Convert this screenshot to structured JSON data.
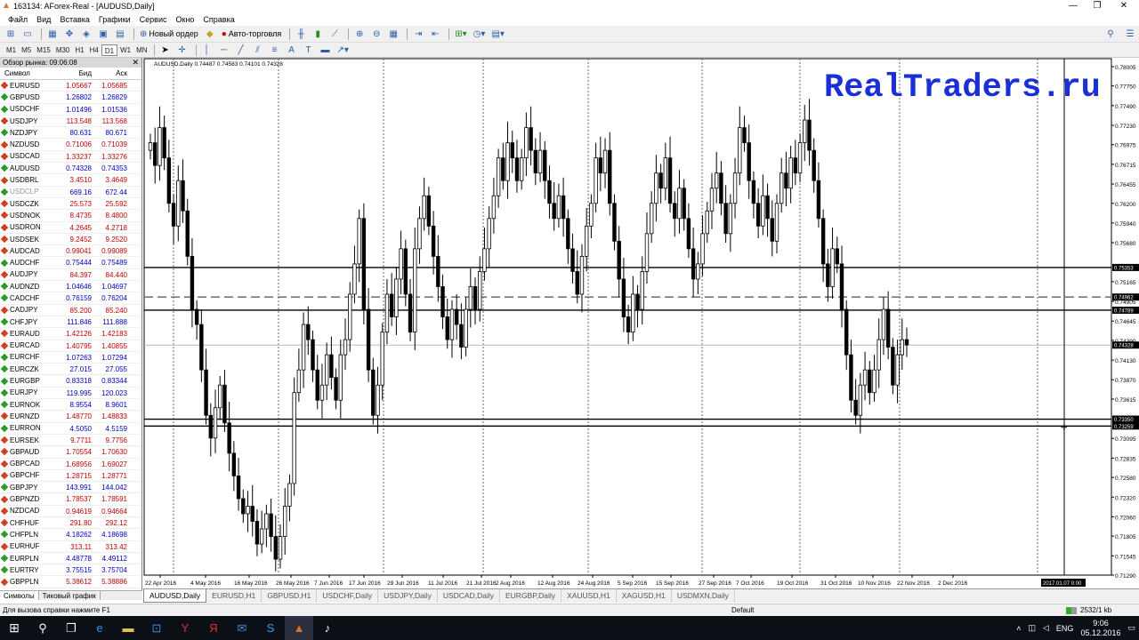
{
  "window": {
    "title": "163134: AForex-Real - [AUDUSD,Daily]"
  },
  "menu": [
    "Файл",
    "Вид",
    "Вставка",
    "Графики",
    "Сервис",
    "Окно",
    "Справка"
  ],
  "toolbar": {
    "new_order": "Новый ордер",
    "autotrade": "Авто-торговля"
  },
  "timeframes": [
    "M1",
    "M5",
    "M15",
    "M30",
    "H1",
    "H4",
    "D1",
    "W1",
    "MN"
  ],
  "timeframe_selected": "D1",
  "market_watch": {
    "title": "Обзор рынка: 09:06:08",
    "col_symbol": "Символ",
    "col_bid": "Бид",
    "col_ask": "Аск",
    "rows": [
      {
        "s": "EURUSD",
        "b": "1.05667",
        "a": "1.05685",
        "c": "#c00000"
      },
      {
        "s": "GBPUSD",
        "b": "1.26802",
        "a": "1.26829",
        "c": "#0000c0"
      },
      {
        "s": "USDCHF",
        "b": "1.01496",
        "a": "1.01536",
        "c": "#0000c0"
      },
      {
        "s": "USDJPY",
        "b": "113.548",
        "a": "113.568",
        "c": "#c00000"
      },
      {
        "s": "NZDJPY",
        "b": "80.631",
        "a": "80.671",
        "c": "#0000c0"
      },
      {
        "s": "NZDUSD",
        "b": "0.71006",
        "a": "0.71039",
        "c": "#c00000"
      },
      {
        "s": "USDCAD",
        "b": "1.33237",
        "a": "1.33276",
        "c": "#c00000"
      },
      {
        "s": "AUDUSD",
        "b": "0.74328",
        "a": "0.74353",
        "c": "#0000c0"
      },
      {
        "s": "USDBRL",
        "b": "3.4510",
        "a": "3.4649",
        "c": "#c00000"
      },
      {
        "s": "USDCLP",
        "b": "669.16",
        "a": "672.44",
        "c": "#0000c0",
        "dim": true
      },
      {
        "s": "USDCZK",
        "b": "25.573",
        "a": "25.592",
        "c": "#c00000"
      },
      {
        "s": "USDNOK",
        "b": "8.4735",
        "a": "8.4800",
        "c": "#c00000"
      },
      {
        "s": "USDRON",
        "b": "4.2645",
        "a": "4.2718",
        "c": "#c00000"
      },
      {
        "s": "USDSEK",
        "b": "9.2452",
        "a": "9.2520",
        "c": "#c00000"
      },
      {
        "s": "AUDCAD",
        "b": "0.99041",
        "a": "0.99089",
        "c": "#c00000"
      },
      {
        "s": "AUDCHF",
        "b": "0.75444",
        "a": "0.75489",
        "c": "#0000c0"
      },
      {
        "s": "AUDJPY",
        "b": "84.397",
        "a": "84.440",
        "c": "#c00000"
      },
      {
        "s": "AUDNZD",
        "b": "1.04646",
        "a": "1.04697",
        "c": "#0000c0"
      },
      {
        "s": "CADCHF",
        "b": "0.76159",
        "a": "0.76204",
        "c": "#0000c0"
      },
      {
        "s": "CADJPY",
        "b": "85.200",
        "a": "85.240",
        "c": "#c00000"
      },
      {
        "s": "CHFJPY",
        "b": "111.846",
        "a": "111.888",
        "c": "#0000c0"
      },
      {
        "s": "EURAUD",
        "b": "1.42126",
        "a": "1.42183",
        "c": "#c00000"
      },
      {
        "s": "EURCAD",
        "b": "1.40795",
        "a": "1.40855",
        "c": "#c00000"
      },
      {
        "s": "EURCHF",
        "b": "1.07263",
        "a": "1.07294",
        "c": "#0000c0"
      },
      {
        "s": "EURCZK",
        "b": "27.015",
        "a": "27.055",
        "c": "#0000c0"
      },
      {
        "s": "EURGBP",
        "b": "0.83318",
        "a": "0.83344",
        "c": "#0000c0"
      },
      {
        "s": "EURJPY",
        "b": "119.995",
        "a": "120.023",
        "c": "#0000c0"
      },
      {
        "s": "EURNOK",
        "b": "8.9554",
        "a": "8.9601",
        "c": "#0000c0"
      },
      {
        "s": "EURNZD",
        "b": "1.48770",
        "a": "1.48833",
        "c": "#c00000"
      },
      {
        "s": "EURRON",
        "b": "4.5050",
        "a": "4.5159",
        "c": "#0000c0"
      },
      {
        "s": "EURSEK",
        "b": "9.7711",
        "a": "9.7756",
        "c": "#c00000"
      },
      {
        "s": "GBPAUD",
        "b": "1.70554",
        "a": "1.70630",
        "c": "#c00000"
      },
      {
        "s": "GBPCAD",
        "b": "1.68956",
        "a": "1.69027",
        "c": "#c00000"
      },
      {
        "s": "GBPCHF",
        "b": "1.28715",
        "a": "1.28771",
        "c": "#c00000"
      },
      {
        "s": "GBPJPY",
        "b": "143.991",
        "a": "144.042",
        "c": "#0000c0"
      },
      {
        "s": "GBPNZD",
        "b": "1.78537",
        "a": "1.78591",
        "c": "#c00000"
      },
      {
        "s": "NZDCAD",
        "b": "0.94619",
        "a": "0.94664",
        "c": "#c00000"
      },
      {
        "s": "CHFHUF",
        "b": "291.80",
        "a": "292.12",
        "c": "#c00000"
      },
      {
        "s": "CHFPLN",
        "b": "4.18262",
        "a": "4.18698",
        "c": "#0000c0"
      },
      {
        "s": "EURHUF",
        "b": "313.11",
        "a": "313.42",
        "c": "#c00000"
      },
      {
        "s": "EURPLN",
        "b": "4.48778",
        "a": "4.49112",
        "c": "#0000c0"
      },
      {
        "s": "EURTRY",
        "b": "3.75515",
        "a": "3.75704",
        "c": "#0000c0"
      },
      {
        "s": "GBPPLN",
        "b": "5.38612",
        "a": "5.38886",
        "c": "#c00000"
      }
    ],
    "tabs": [
      "Символы",
      "Тиковый график"
    ]
  },
  "chart": {
    "header": "AUDUSD,Daily  0.74487 0.74583 0.74101 0.74328",
    "watermark": "RealTraders.ru",
    "price_labels": [
      "0.78005",
      "0.77750",
      "0.77490",
      "0.77230",
      "0.76975",
      "0.76715",
      "0.76455",
      "0.76200",
      "0.75940",
      "0.75680",
      "0.75165",
      "0.74905",
      "0.74645",
      "0.74390",
      "0.74130",
      "0.73870",
      "0.73615",
      "0.73095",
      "0.72835",
      "0.72580",
      "0.72320",
      "0.72060",
      "0.71805",
      "0.71545",
      "0.71290"
    ],
    "hline_labels": [
      "0.75353",
      "0.74962",
      "0.74789",
      "0.74328",
      "0.73350",
      "0.73259"
    ],
    "date_labels": [
      "22 Apr 2016",
      "4 May 2016",
      "16 May 2016",
      "26 May 2016",
      "7 Jun 2016",
      "17 Jun 2016",
      "29 Jun 2016",
      "11 Jul 2016",
      "21 Jul 2016",
      "2 Aug 2016",
      "12 Aug 2016",
      "24 Aug 2016",
      "5 Sep 2016",
      "15 Sep 2016",
      "27 Sep 2016",
      "7 Oct 2016",
      "19 Oct 2016",
      "31 Oct 2016",
      "10 Nov 2016",
      "22 Nov 2016",
      "2 Dec 2016"
    ],
    "cursor_time": "2017.01.07 0:00"
  },
  "chart_tabs": [
    "AUDUSD,Daily",
    "EURUSD,H1",
    "GBPUSD,H1",
    "USDCHF,Daily",
    "USDJPY,Daily",
    "USDCAD,Daily",
    "EURGBP,Daily",
    "XAUUSD,H1",
    "XAGUSD,H1",
    "USDMXN,Daily"
  ],
  "status": {
    "help": "Для вызова справки нажмите F1",
    "profile": "Default",
    "traffic": "2532/1 kb"
  },
  "taskbar": {
    "lang": "ENG",
    "time": "9:06",
    "date": "05.12.2016"
  }
}
